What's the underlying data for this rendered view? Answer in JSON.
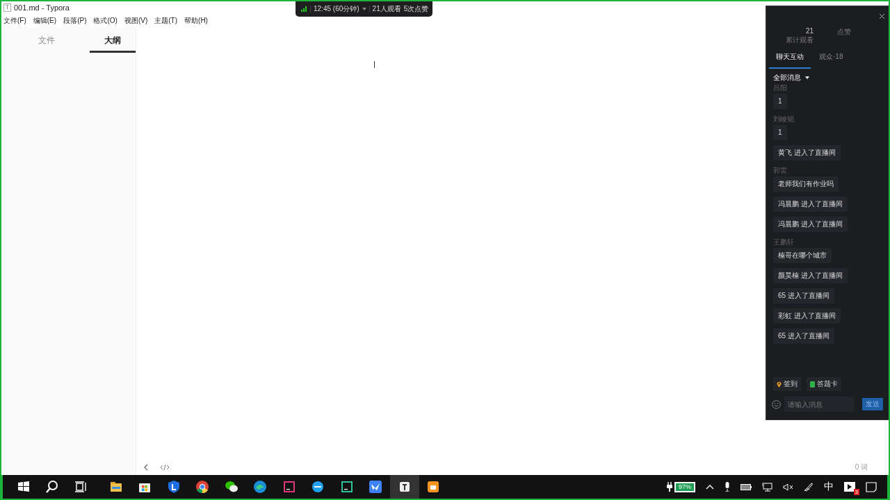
{
  "window": {
    "app_icon": "T",
    "title": "001.md - Typora"
  },
  "menu": [
    "文件(F)",
    "编辑(E)",
    "段落(P)",
    "格式(O)",
    "视图(V)",
    "主题(T)",
    "帮助(H)"
  ],
  "sidebar": {
    "tabs": [
      {
        "label": "文件",
        "selected": false
      },
      {
        "label": "大纲",
        "selected": true
      }
    ]
  },
  "status_bar": {
    "word_count": "0 词"
  },
  "live_bar": {
    "duration": "12:45 (60分钟)",
    "viewers": "21人观看",
    "likes": "5次点赞"
  },
  "chat": {
    "stats": [
      {
        "value": "21",
        "label": "累计观看"
      },
      {
        "label": "点赞"
      }
    ],
    "tabs": [
      {
        "label": "聊天互动",
        "selected": true
      },
      {
        "label": "观众·18",
        "selected": false
      }
    ],
    "filter": "全部消息",
    "messages": [
      {
        "kind": "name",
        "text": "吕阳"
      },
      {
        "kind": "bubble",
        "text": "1"
      },
      {
        "kind": "name",
        "text": "刘峻韬"
      },
      {
        "kind": "bubble",
        "text": "1"
      },
      {
        "kind": "bubble",
        "text": "黄飞 进入了直播间"
      },
      {
        "kind": "name",
        "text": "郭雷"
      },
      {
        "kind": "bubble",
        "text": "老师我们有作业吗"
      },
      {
        "kind": "bubble",
        "text": "冯晨鹏 进入了直播间"
      },
      {
        "kind": "bubble",
        "text": "冯晨鹏 进入了直播间"
      },
      {
        "kind": "name",
        "text": "王鹏轩"
      },
      {
        "kind": "bubble",
        "text": "楠哥在哪个城市"
      },
      {
        "kind": "bubble",
        "text": "颜昊楠 进入了直播间"
      },
      {
        "kind": "bubble",
        "text": "65 进入了直播间"
      },
      {
        "kind": "bubble",
        "text": "彩虹 进入了直播间"
      },
      {
        "kind": "bubble",
        "text": "65 进入了直播间"
      }
    ],
    "actions": [
      {
        "kind": "pin",
        "label": "签到"
      },
      {
        "kind": "card",
        "label": "答题卡"
      }
    ],
    "input": {
      "placeholder": "请输入消息"
    },
    "send": "发送"
  },
  "taskbar": {
    "apps": [
      {
        "kind": "folder",
        "selected": false
      },
      {
        "kind": "store",
        "selected": false
      },
      {
        "kind": "shield",
        "selected": false
      },
      {
        "kind": "chrome",
        "selected": false
      },
      {
        "kind": "wechat",
        "selected": false
      },
      {
        "kind": "edge",
        "selected": false
      },
      {
        "kind": "ij",
        "selected": false
      },
      {
        "kind": "ie",
        "selected": false
      },
      {
        "kind": "dg",
        "selected": false
      },
      {
        "kind": "bird",
        "selected": false
      },
      {
        "kind": "typora",
        "selected": true
      },
      {
        "kind": "bag",
        "selected": false
      }
    ],
    "battery": "97%",
    "ime": "中",
    "notification_count": "3"
  }
}
